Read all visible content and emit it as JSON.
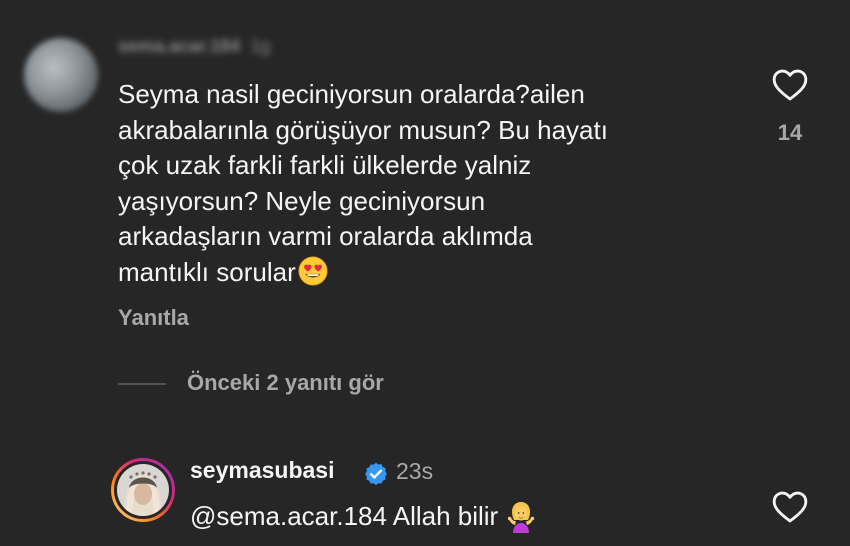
{
  "comment": {
    "username": "sema.acar.184",
    "time": "1g",
    "text_lines": [
      "Seyma nasil geciniyorsun oralarda?ailen",
      "akrabalarınla görüşüyor musun? Bu hayatı",
      "çok uzak farkli farkli ülkelerde yalniz",
      "yaşıyorsun? Neyle geciniyorsun",
      "arkadaşların varmi oralarda aklımda",
      "mantıklı sorular"
    ],
    "emoji": "heart-eyes-emoji",
    "like_count": "14",
    "reply_label": "Yanıtla"
  },
  "replies_toggle": {
    "label": "Önceki 2 yanıtı gör"
  },
  "reply": {
    "username": "seymasubasi",
    "time": "23s",
    "text": "@sema.acar.184 Allah bilir",
    "emoji": "person-shrugging-emoji"
  },
  "colors": {
    "background": "#262626",
    "text_primary": "#f5f5f5",
    "text_secondary": "#a8a8a8",
    "verified_blue": "#3897f0"
  }
}
